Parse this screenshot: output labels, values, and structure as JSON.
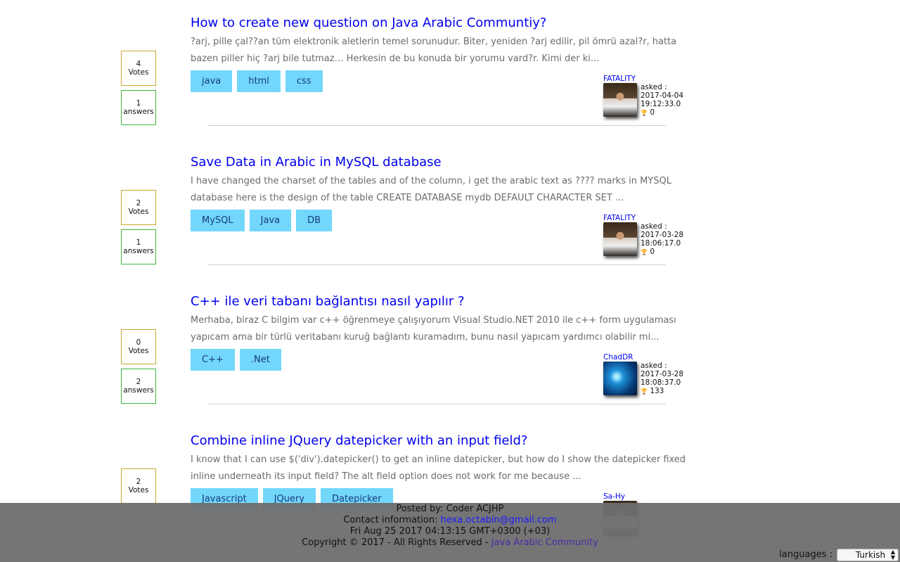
{
  "questions": [
    {
      "title": "How to create new question on Java Arabic Communtiy?",
      "excerpt": "?arj, pille çal??an tüm elektronik aletlerin temel sorunudur. Biter, yeniden ?arj edilir, pil ömrü azal?r, hatta bazen piller hiç ?arj bile tutmaz… Herkesin de bu konuda bir yorumu vard?r. Kimi der ki...",
      "votes": "4",
      "votes_label": "Votes",
      "answers": "1",
      "answers_label": "answers",
      "tags": [
        "java",
        "html",
        "css"
      ],
      "author": "FATALITY",
      "asked_label": "asked :",
      "date": "2017-04-04",
      "time": "19:12:33.0",
      "views": "0"
    },
    {
      "title": "Save Data in Arabic in MySQL database",
      "excerpt": "I have changed the charset of the tables and of the column, i get the arabic text as ???? marks in MYSQL database here is the design of the table CREATE DATABASE mydb DEFAULT CHARACTER SET ...",
      "votes": "2",
      "votes_label": "Votes",
      "answers": "1",
      "answers_label": "answers",
      "tags": [
        "MySQL",
        "Java",
        "DB"
      ],
      "author": "FATALITY",
      "asked_label": "asked :",
      "date": "2017-03-28",
      "time": "18:06:17.0",
      "views": "0"
    },
    {
      "title": "C++ ile veri tabanı bağlantısı nasıl yapılır ?",
      "excerpt": "Merhaba, biraz C bilgim var c++ öğrenmeye çalışıyorum Visual Studio.NET 2010 ile c++ form uygulaması yapıcam ama bir türlü veritabanı kuruğ bağlantı kuramadım, bunu nasıl yapıcam yardımcı olabilir mi...",
      "votes": "0",
      "votes_label": "Votes",
      "answers": "2",
      "answers_label": "answers",
      "tags": [
        "C++",
        ".Net"
      ],
      "author": "ChadDR",
      "asked_label": "asked :",
      "date": "2017-03-28",
      "time": "18:08:37.0",
      "views": "133"
    },
    {
      "title": "Combine inline JQuery datepicker with an input field?",
      "excerpt": "I know that I can use $('div').datepicker() to get an inline datepicker, but how do I show the datepicker fixed inline underneath its input field? The alt field option does not work for me because ...",
      "votes": "2",
      "votes_label": "Votes",
      "tags": [
        "Javascript",
        "JQuery",
        "Datepicker"
      ],
      "author": "Sa-Hy"
    }
  ],
  "footer": {
    "posted_by": "Posted by: Coder ACJHP",
    "contact_label": "Contact information:",
    "contact_email": "hexa.octabin@gmail.com",
    "datetime": "Fri Aug 25 2017 04:13:15 GMT+0300 (+03)",
    "copyright": "Copyright © 2017 - All Rights Reserved -",
    "community_link": "Java Arabic Community"
  },
  "languages": {
    "label": "languages :",
    "selected": "Turkish"
  },
  "colors": {
    "title_link": "#0000ee",
    "tag_bg": "#72d7fb",
    "votes_border": "#c8a82e",
    "answers_border": "#3fb53f",
    "footer_bg": "#6e6e6e"
  }
}
